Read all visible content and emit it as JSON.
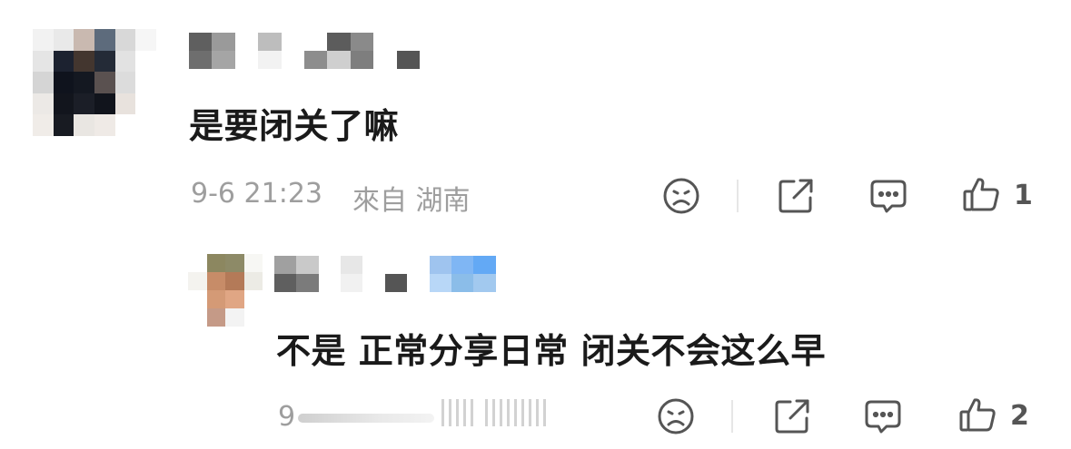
{
  "comment": {
    "text": "是要闭关了嘛",
    "date": "9-6 21:23",
    "source": "來自 湖南",
    "like_count": "1"
  },
  "reply": {
    "text": "不是 正常分享日常 闭关不会这么早",
    "date_prefix": "9",
    "like_count": "2"
  },
  "icons": {
    "dislike": "sad-face-icon",
    "share": "share-icon",
    "reply": "comment-bubble-icon",
    "like": "thumbs-up-icon"
  },
  "colors": {
    "text": "#1a1a1a",
    "meta": "#9e9e9e",
    "icon": "#555555"
  }
}
